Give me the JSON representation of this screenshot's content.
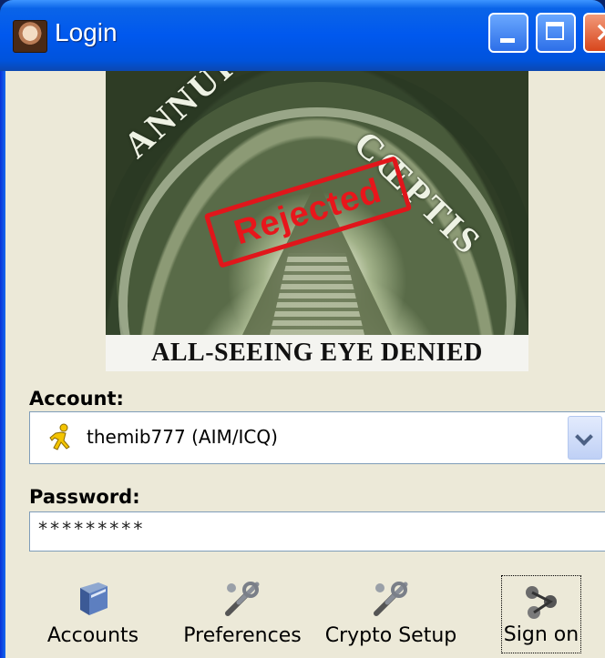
{
  "window": {
    "title": "Login",
    "app_icon": "pidgin-face-icon",
    "controls": [
      "minimize-icon",
      "maximize-icon",
      "close-icon"
    ]
  },
  "banner": {
    "motto_left": "ANNUIT",
    "motto_right": "CŒPTIS",
    "stamp": "Rejected",
    "caption": "ALL-SEEING EYE DENIED"
  },
  "form": {
    "account_label": "Account:",
    "account_value": "themib777 (AIM/ICQ)",
    "account_icon": "aim-runner-icon",
    "password_label": "Password:",
    "password_value": "*********"
  },
  "toolbar": {
    "accounts": "Accounts",
    "preferences": "Preferences",
    "crypto_setup": "Crypto Setup",
    "sign_on": "Sign on"
  }
}
